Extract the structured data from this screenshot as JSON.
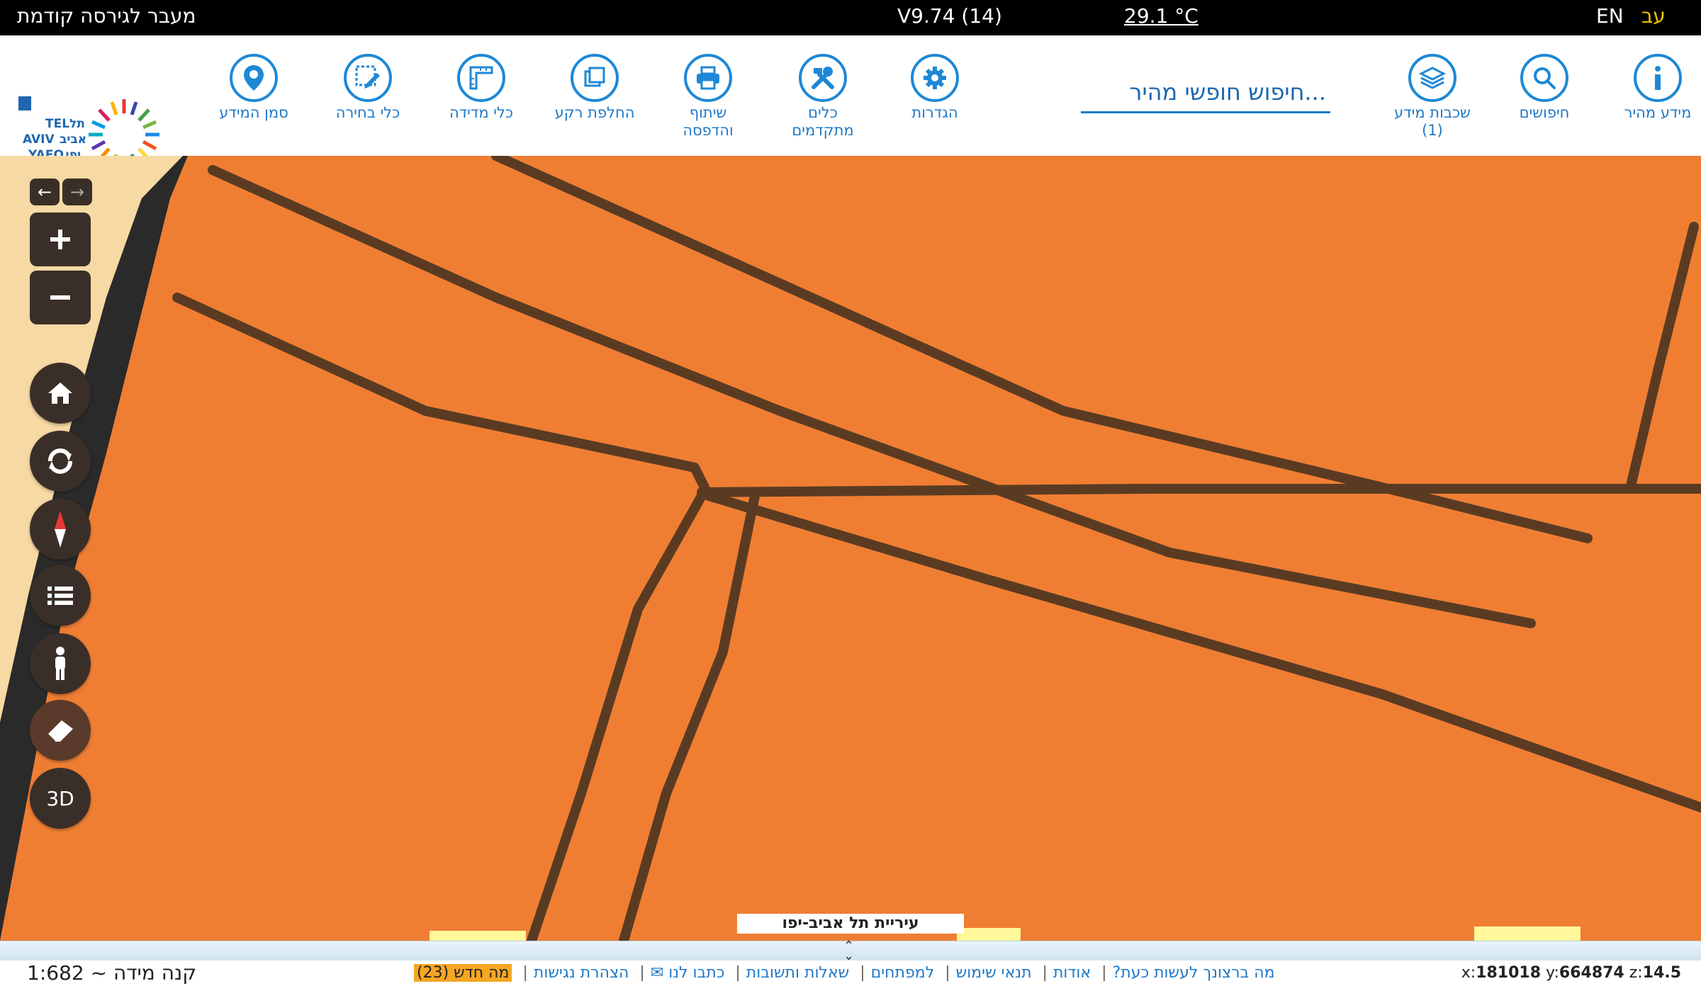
{
  "topbar": {
    "prev_version": "מעבר לגירסה קודמת",
    "version": "V9.74 (14)",
    "temperature": "29.1 °C",
    "lang_en": "EN",
    "lang_he": "עב"
  },
  "toolbar": {
    "quick_info": "מידע מהיר",
    "searches": "חיפושים",
    "layers_line1": "שכבות מידע",
    "layers_line2": "(1)",
    "search_placeholder": "חיפוש חופשי מהיר...",
    "settings": "הגדרות",
    "advanced_line1": "כלים",
    "advanced_line2": "מתקדמים",
    "share_line1": "שיתוף",
    "share_line2": "והדפסה",
    "basemap": "החלפת רקע",
    "measure": "כלי מדידה",
    "select": "כלי בחירה",
    "marker": "סמן המידע"
  },
  "logo": {
    "text_tel": "TEL",
    "text_aviv": "AVIV",
    "text_yafo": "YAFO",
    "text_he1": "תל",
    "text_he2": "אביב",
    "text_he3": "יפו"
  },
  "map": {
    "city_label": "עיריית תל אביב-יפו",
    "controls": {
      "three_d": "3D"
    }
  },
  "footer": {
    "scale": "קנה מידה ~ 1:682",
    "links": [
      "מה ברצונך לעשות כעת?",
      "אודות",
      "תנאי שימוש",
      "למפתחים",
      "שאלות ותשובות",
      "כתבו לנו ✉",
      "הצהרת נגישות"
    ],
    "whats_new": "מה חדש (23)",
    "coord_x_label": "x:",
    "coord_x": "181018",
    "coord_y_label": "y:",
    "coord_y": "664874",
    "coord_z_label": "z:",
    "coord_z": "14.5"
  },
  "colors": {
    "accent": "#1e78c8",
    "map_fill": "#ef7e33",
    "control_bg": "#3a2f28"
  }
}
